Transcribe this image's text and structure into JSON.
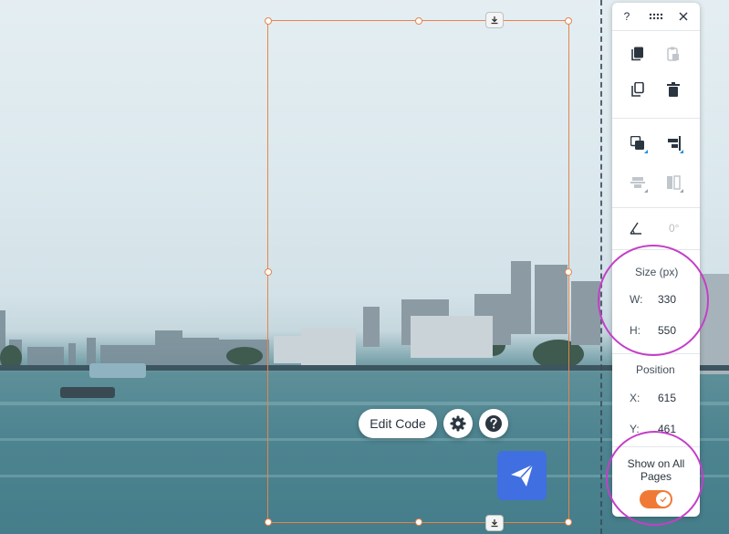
{
  "canvas": {
    "toolbar": {
      "edit_code_label": "Edit Code",
      "settings_icon": "gear-icon",
      "help_icon": "question-icon"
    },
    "widget_icon": "paper-plane-icon",
    "selection_color": "#e8844b"
  },
  "panel": {
    "header": {
      "help": "?",
      "drag_icon": "drag-dots-icon",
      "close_icon": "close-icon"
    },
    "rotation": {
      "icon": "angle-icon",
      "value": "0°"
    },
    "size": {
      "title": "Size (px)",
      "w_label": "W:",
      "w_value": "330",
      "h_label": "H:",
      "h_value": "550"
    },
    "position": {
      "title": "Position",
      "x_label": "X:",
      "x_value": "615",
      "y_label": "Y:",
      "y_value": "461"
    },
    "show_all": {
      "label_line1": "Show on All",
      "label_line2": "Pages",
      "enabled": true
    },
    "accent": "#f07a35"
  }
}
